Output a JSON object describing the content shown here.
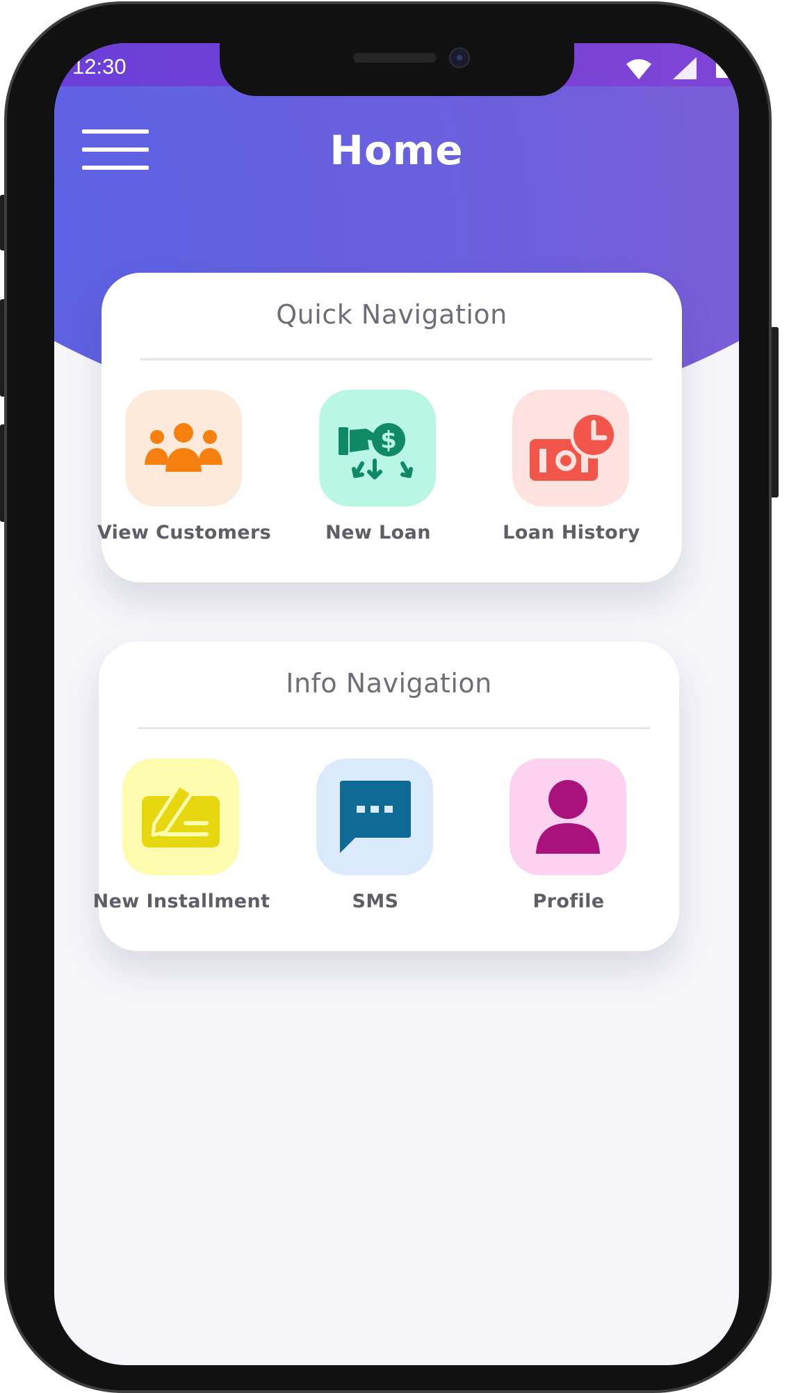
{
  "status_bar": {
    "time": "12:30"
  },
  "header": {
    "title": "Home",
    "menu_icon": "hamburger-menu-icon"
  },
  "quick_navigation": {
    "title": "Quick Navigation",
    "items": [
      {
        "label": "View Customers",
        "icon": "customers-icon",
        "tile_color": "#fdeadb",
        "icon_color": "#f5800f"
      },
      {
        "label": "New Loan",
        "icon": "loan-icon",
        "tile_color": "#b9f7e4",
        "icon_color": "#0f8a62"
      },
      {
        "label": "Loan History",
        "icon": "loan-history-icon",
        "tile_color": "#fde2df",
        "icon_color": "#f2564a"
      }
    ]
  },
  "info_navigation": {
    "title": "Info Navigation",
    "items": [
      {
        "label": "New Installment",
        "icon": "installment-icon",
        "tile_color": "#fdfbae",
        "icon_color": "#e6d711"
      },
      {
        "label": "SMS",
        "icon": "sms-icon",
        "tile_color": "#dbe9fd",
        "icon_color": "#0f6a96"
      },
      {
        "label": "Profile",
        "icon": "profile-icon",
        "tile_color": "#fdd2f0",
        "icon_color": "#a8127a"
      }
    ]
  },
  "colors": {
    "header_gradient_start": "#5a62e4",
    "header_gradient_end": "#9a5acc",
    "page_background": "#f5f5fa"
  }
}
